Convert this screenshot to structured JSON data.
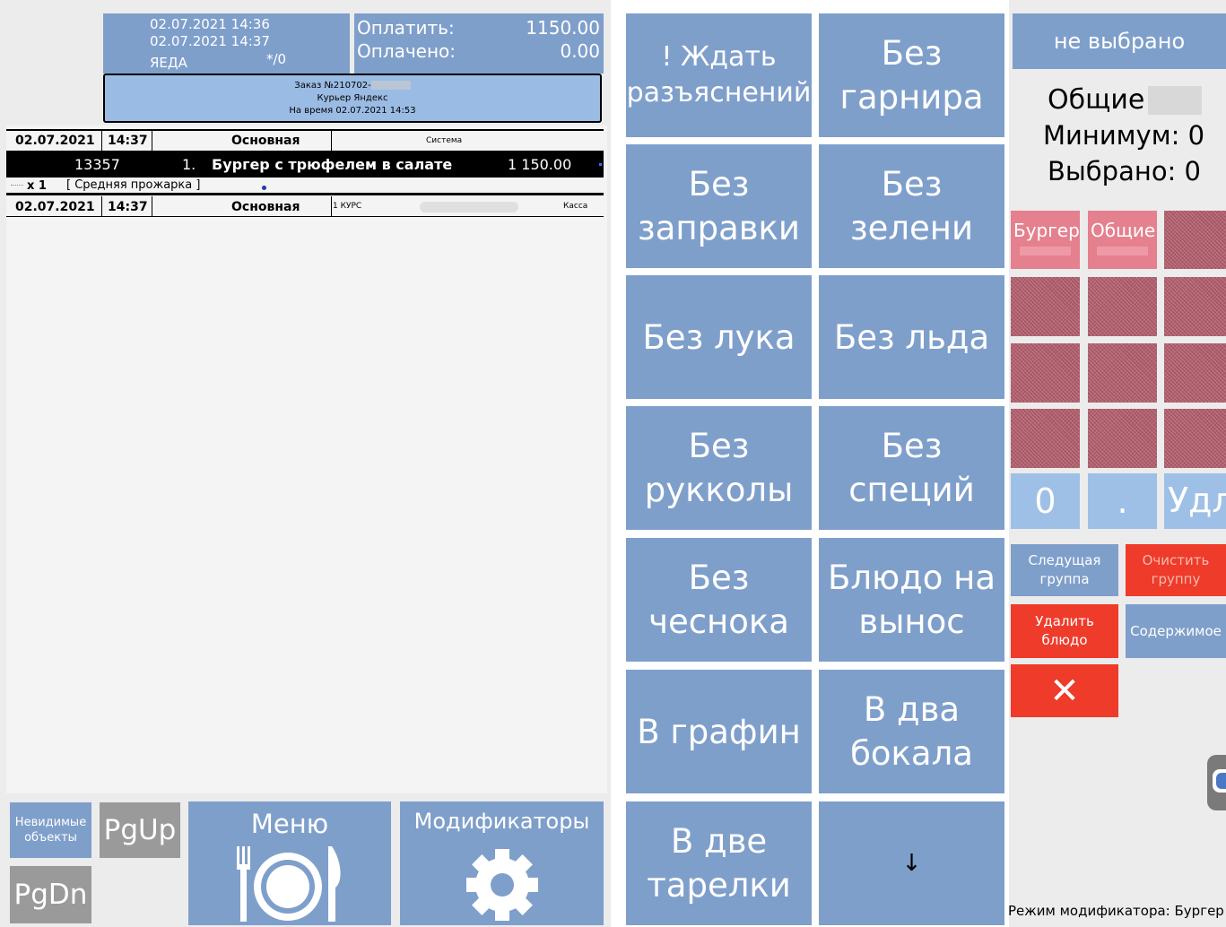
{
  "order_header": {
    "datetime1": "02.07.2021 14:36",
    "datetime2": "02.07.2021 14:37",
    "source": "ЯЕДА",
    "guests": "*/0",
    "pay_label": "Оплатить:",
    "pay_value": "1150.00",
    "paid_label": "Оплачено:",
    "paid_value": "0.00",
    "order_line": "Заказ №210702-",
    "courier_line": "Курьер Яндекс",
    "time_line": "На время 02.07.2021 14:53"
  },
  "order_rows": [
    {
      "date": "02.07.2021",
      "time": "14:37",
      "type": "Основная",
      "extra": "Система",
      "right": ""
    },
    {
      "date": "02.07.2021",
      "time": "14:37",
      "type": "Основная",
      "extra": "1 КУРС",
      "right": "Касса"
    }
  ],
  "dish": {
    "code": "13357",
    "num": "1.",
    "name": "Бургер с трюфелем в салате",
    "price": "1 150.00",
    "qty": "x 1",
    "modifier": "[ Средняя прожарка ]"
  },
  "bottom_bar": {
    "invisible": "Невидимые\nобъекты",
    "pgup": "PgUp",
    "pgdn": "PgDn",
    "menu": "Меню",
    "modifiers": "Модификаторы"
  },
  "modifier_buttons": [
    "! Ждать\nразъяснений",
    "Без\nгарнира",
    "Без\nзаправки",
    "Без\nзелени",
    "Без лука",
    "Без льда",
    "Без\nрукколы",
    "Без\nспеций",
    "Без\nчеснока",
    "Блюдо на\nвынос",
    "В графин",
    "В два\nбокала",
    "В две\nтарелки"
  ],
  "down_arrow": "↓",
  "right_panel": {
    "not_selected": "не выбрано",
    "general": "Общие",
    "minimum": "Минимум: 0",
    "selected": "Выбрано: 0",
    "group_burger": "Бургер",
    "group_general": "Общие",
    "key_zero": "0",
    "key_dot": ".",
    "key_del": "Удл",
    "next_group": "Следущая\nгруппа",
    "clear_group": "Очистить\nгруппу",
    "delete_dish": "Удалить\nблюдо",
    "contents": "Содержимое",
    "close": "✕",
    "status": "Режим модификатора: Бургер"
  },
  "colors": {
    "button_blue": "#7f9fcb",
    "red": "#ee3b2a",
    "pink": "#e5808e",
    "hatch": "#b25d6c",
    "gray": "#9a9a9a"
  }
}
